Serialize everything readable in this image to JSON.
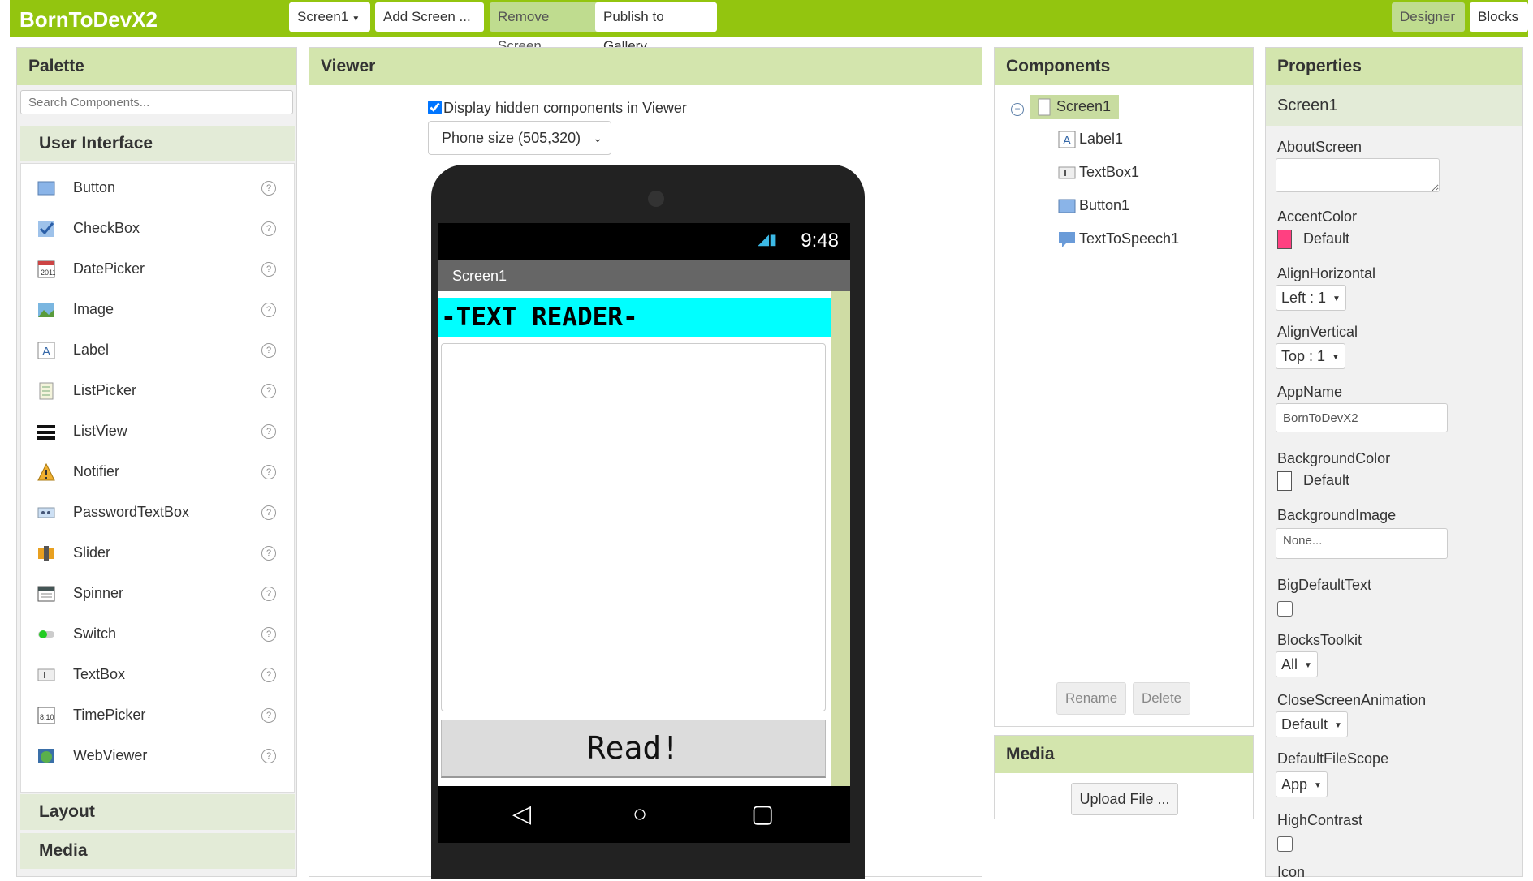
{
  "app": {
    "title": "BornToDevX2"
  },
  "toolbar": {
    "screen_select": "Screen1",
    "add_screen": "Add Screen ...",
    "remove_screen": "Remove Screen",
    "publish": "Publish to Gallery",
    "designer": "Designer",
    "blocks": "Blocks"
  },
  "palette": {
    "title": "Palette",
    "search_placeholder": "Search Components...",
    "category_ui": "User Interface",
    "items": [
      {
        "label": "Button",
        "icon": "button-icon"
      },
      {
        "label": "CheckBox",
        "icon": "checkbox-icon"
      },
      {
        "label": "DatePicker",
        "icon": "datepicker-icon"
      },
      {
        "label": "Image",
        "icon": "image-icon"
      },
      {
        "label": "Label",
        "icon": "label-icon"
      },
      {
        "label": "ListPicker",
        "icon": "listpicker-icon"
      },
      {
        "label": "ListView",
        "icon": "listview-icon"
      },
      {
        "label": "Notifier",
        "icon": "notifier-icon"
      },
      {
        "label": "PasswordTextBox",
        "icon": "password-icon"
      },
      {
        "label": "Slider",
        "icon": "slider-icon"
      },
      {
        "label": "Spinner",
        "icon": "spinner-icon"
      },
      {
        "label": "Switch",
        "icon": "switch-icon"
      },
      {
        "label": "TextBox",
        "icon": "textbox-icon"
      },
      {
        "label": "TimePicker",
        "icon": "timepicker-icon"
      },
      {
        "label": "WebViewer",
        "icon": "webviewer-icon"
      }
    ],
    "category_layout": "Layout",
    "category_media": "Media"
  },
  "viewer": {
    "title": "Viewer",
    "hidden_checkbox": "Display hidden components in Viewer",
    "size_select": "Phone size (505,320)",
    "status_time": "9:48",
    "screen_title": "Screen1",
    "label_text": "-TEXT READER-",
    "button_text": "Read!"
  },
  "components": {
    "title": "Components",
    "tree": [
      "Screen1",
      "Label1",
      "TextBox1",
      "Button1",
      "TextToSpeech1"
    ],
    "rename": "Rename",
    "delete": "Delete"
  },
  "media": {
    "title": "Media",
    "upload": "Upload File ..."
  },
  "properties": {
    "title": "Properties",
    "component": "Screen1",
    "about_screen": "AboutScreen",
    "accent_color": "AccentColor",
    "accent_value": "Default",
    "align_h": "AlignHorizontal",
    "align_h_value": "Left : 1",
    "align_v": "AlignVertical",
    "align_v_value": "Top : 1",
    "app_name": "AppName",
    "app_name_value": "BornToDevX2",
    "bg_color": "BackgroundColor",
    "bg_color_value": "Default",
    "bg_image": "BackgroundImage",
    "bg_image_value": "None...",
    "big_default_text": "BigDefaultText",
    "blocks_toolkit": "BlocksToolkit",
    "blocks_toolkit_value": "All",
    "close_anim": "CloseScreenAnimation",
    "close_anim_value": "Default",
    "file_scope": "DefaultFileScope",
    "file_scope_value": "App",
    "high_contrast": "HighContrast",
    "icon": "Icon"
  },
  "colors": {
    "brand": "#93c50f",
    "panel_head": "#d3e5ad",
    "accent": "#ff4081",
    "label_bg": "#00ffff"
  }
}
